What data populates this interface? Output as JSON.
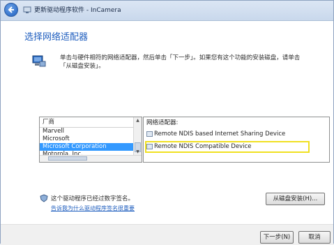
{
  "window": {
    "title": "更新驱动程序软件 - InCamera"
  },
  "page": {
    "heading": "选择网络适配器",
    "intro": "单击与硬件相符的网络适配器，然后单击「下一步」。如果您有这个功能的安装磁盘，请单击「从磁盘安装」。"
  },
  "manufacturer_list": {
    "header": "厂商",
    "items": [
      "Marvell",
      "Microsoft",
      "Microsoft Corporation",
      "Motorola, Inc."
    ],
    "selected": "Microsoft Corporation"
  },
  "model_list": {
    "header": "网络适配器:",
    "items": [
      "Remote NDIS based Internet Sharing Device",
      "Remote NDIS Compatible Device"
    ],
    "highlighted": "Remote NDIS Compatible Device"
  },
  "signature": {
    "text": "这个驱动程序已经过数字签名。",
    "link": "告诉我为什么驱动程序签名很重要"
  },
  "buttons": {
    "have_disk": "从磁盘安装(H)...",
    "next": "下一步(N)",
    "cancel": "取消"
  },
  "icons": {
    "back": "back-arrow-icon",
    "title": "device-icon",
    "intro": "network-adapter-icon",
    "signature": "shield-icon"
  },
  "colors": {
    "heading": "#1e5dbe",
    "selection": "#3399ff",
    "highlight": "#f0e020"
  }
}
